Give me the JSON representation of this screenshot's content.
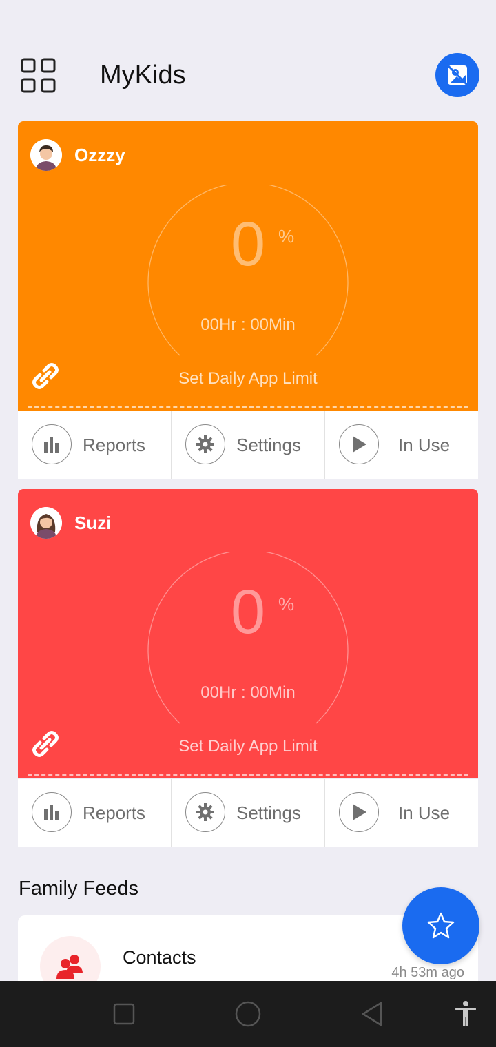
{
  "app": {
    "title": "MyKids"
  },
  "header": {
    "menu_icon": "grid-icon",
    "action_icon": "gallery-icon",
    "accent": "#1a6bf0"
  },
  "kids": [
    {
      "name": "Ozzzy",
      "color": "#ff8800",
      "usage_value": "0",
      "usage_unit": "%",
      "time_used": "00Hr : 00Min",
      "limit_label": "Set Daily App Limit",
      "actions": [
        "Reports",
        "Settings",
        "In Use"
      ]
    },
    {
      "name": "Suzi",
      "color": "#ff4646",
      "usage_value": "0",
      "usage_unit": "%",
      "time_used": "00Hr : 00Min",
      "limit_label": "Set Daily App Limit",
      "actions": [
        "Reports",
        "Settings",
        "In Use"
      ]
    }
  ],
  "feeds": {
    "title": "Family Feeds",
    "items": [
      {
        "title": "Contacts",
        "time": "4h 53m ago",
        "icon": "contacts-icon"
      }
    ]
  },
  "fab": {
    "icon": "star-icon"
  },
  "navbar": {
    "icons": [
      "recent-apps-icon",
      "home-icon",
      "back-icon",
      "accessibility-icon"
    ]
  }
}
